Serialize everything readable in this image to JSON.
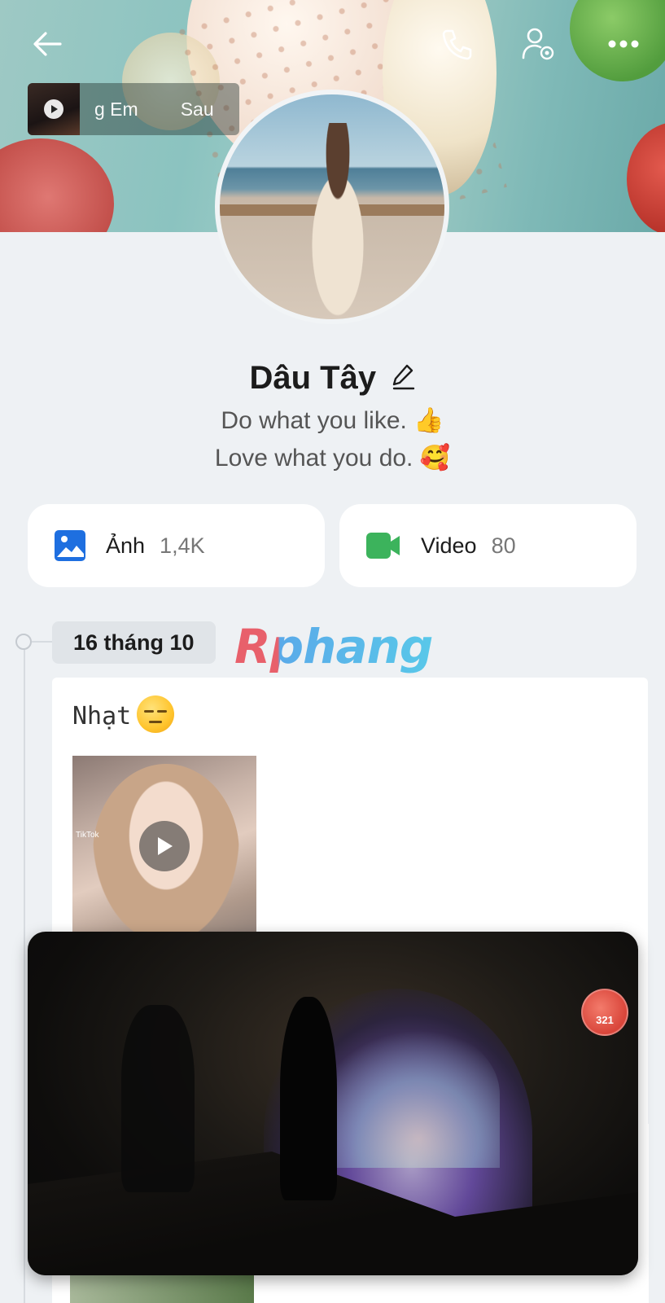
{
  "header": {
    "back_icon": "arrow-left-icon",
    "call_icon": "phone-icon",
    "settings_icon": "user-gear-icon",
    "more_icon": "more-dots-icon"
  },
  "music": {
    "title_part1": "g Em",
    "title_part2": "Sau",
    "play_icon": "play-icon"
  },
  "profile": {
    "name": "Dâu Tây",
    "bio_line1": "Do what you like.  👍",
    "bio_line2": "Love what you do. 🥰"
  },
  "media": [
    {
      "label": "Ảnh",
      "count": "1,4K",
      "icon": "image-icon",
      "color": "#1e6fe0"
    },
    {
      "label": "Video",
      "count": "80",
      "icon": "video-camera-icon",
      "color": "#3cb35c"
    }
  ],
  "timeline": {
    "date": "16 tháng 10",
    "watermark": "Rphang"
  },
  "post": {
    "text": "Nhạt",
    "emoji": "expressionless-face-emoji",
    "video_overlay": "TikTok"
  },
  "player": {
    "badge": "321"
  }
}
